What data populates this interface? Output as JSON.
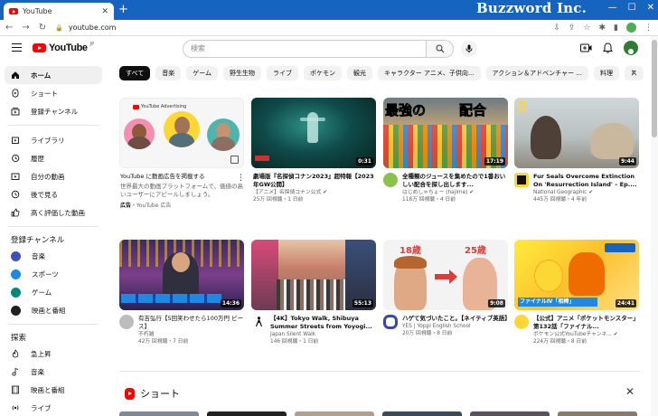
{
  "browser": {
    "tab_title": "YouTube",
    "tab_close": "✕",
    "new_tab": "+",
    "url": "youtube.com",
    "overlay_brand": "Buzzword Inc.",
    "controls": [
      "—",
      "☐",
      "✕"
    ]
  },
  "header": {
    "logo_text": "YouTube",
    "logo_sup": "JP",
    "search_placeholder": "検索"
  },
  "sidebar": {
    "main": [
      {
        "label": "ホーム",
        "icon": "home-icon",
        "active": true
      },
      {
        "label": "ショート",
        "icon": "shorts-icon"
      },
      {
        "label": "登録チャンネル",
        "icon": "subscriptions-icon"
      }
    ],
    "library": [
      {
        "label": "ライブラリ",
        "icon": "library-icon"
      },
      {
        "label": "履歴",
        "icon": "history-icon"
      },
      {
        "label": "自分の動画",
        "icon": "my-videos-icon"
      },
      {
        "label": "後で見る",
        "icon": "watch-later-icon"
      },
      {
        "label": "高く評価した動画",
        "icon": "liked-icon"
      }
    ],
    "subscriptions_header": "登録チャンネル",
    "subscriptions": [
      {
        "label": "音楽",
        "color": "#3f51b5"
      },
      {
        "label": "スポーツ",
        "color": "#1e88e5"
      },
      {
        "label": "ゲーム",
        "color": "#00897b"
      },
      {
        "label": "映画と番組",
        "color": "#212121"
      }
    ],
    "explore_header": "探索",
    "explore": [
      {
        "label": "急上昇",
        "icon": "trending-icon"
      },
      {
        "label": "音楽",
        "icon": "music-icon"
      },
      {
        "label": "映画と番組",
        "icon": "movies-icon"
      },
      {
        "label": "ライブ",
        "icon": "live-icon"
      }
    ]
  },
  "chips": [
    "すべて",
    "音楽",
    "ゲーム",
    "野生生物",
    "ライブ",
    "ポケモン",
    "観光",
    "キャラクター アニメ、子供向...",
    "アクション＆アドベンチャー ...",
    "料理",
    "ス"
  ],
  "ad": {
    "brand": "YouTube Advertising",
    "title": "YouTube に動画広告を掲載する",
    "desc": "世界最大の動画プラットフォームで、価値の高いユーザーにアピールしましょう。",
    "badge": "広告",
    "sponsor": "・YouTube 広告"
  },
  "videos_row1": [
    {
      "title": "劇場版『名探偵コナン2023』超特報【2023年GW公開】",
      "channel": "【アニメ】名探偵コナン公式 ✔",
      "stats": "25万 回視聴・1 日前",
      "duration": "0:31"
    },
    {
      "title": "全種類のジュースを集めたので1番おいしい配合を探し出します...",
      "channel": "はじめしゃちょー (hajime) ✔",
      "stats": "118万 回視聴・4 日前",
      "duration": "17:19",
      "thumb_text_a": "最強の",
      "thumb_text_b": "配合"
    },
    {
      "title": "Fur Seals Overcome Extinction On 'Resurrection Island' – Ep....",
      "channel": "National Geographic ✔",
      "stats": "445万 回視聴・4 年前",
      "duration": "9:44"
    }
  ],
  "videos_row2": [
    {
      "title": "有吉弘行【5回笑わせたら100万円 ピース】",
      "channel": "不朽雑",
      "stats": "42万 回視聴・7 日前",
      "duration": "14:36"
    },
    {
      "title": "【4K】Tokyo Walk, Shibuya Summer Streets from Yoyogi...",
      "channel": "Japan Silent Walk",
      "stats": "146 回視聴・1 日前",
      "duration": "55:13"
    },
    {
      "title": "ハゲて気づいたこと。【ネイティブ英語】",
      "channel": "YES | Yoppi English School",
      "stats": "20万 回視聴・8 日前",
      "duration": "9:08",
      "thumb_age_a": "18歳",
      "thumb_age_b": "25歳"
    },
    {
      "title": "【公式】アニメ「ポケットモンスター」第132話「ファイナル...",
      "channel": "ポケモン公式YouTubeチャンネ... ✔",
      "stats": "224万 回視聴・8 日前",
      "duration": "24:41",
      "thumb_text": "ファイナルⅣ「相棒」"
    }
  ],
  "shorts": {
    "label": "ショート",
    "close": "✕"
  }
}
